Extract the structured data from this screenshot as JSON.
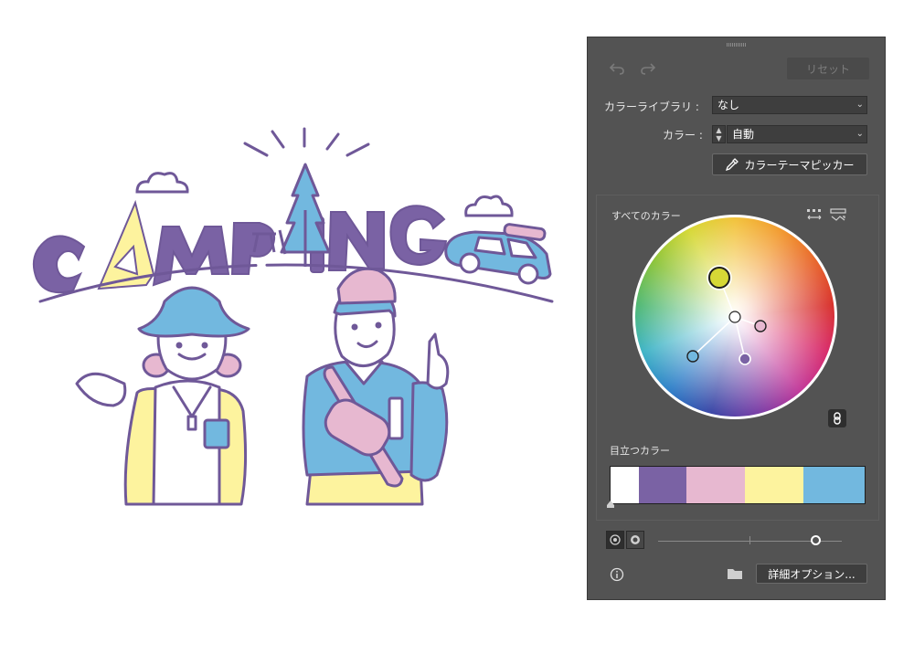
{
  "artwork": {
    "title_text": "CAMPING",
    "palette": {
      "purple": "#7a62a4",
      "pink": "#e7b8d0",
      "yellow": "#fdf39e",
      "blue": "#72b8df",
      "line": "#6f5898"
    }
  },
  "panel": {
    "undo_icon": "undo-icon",
    "redo_icon": "redo-icon",
    "reset_label": "リセット",
    "library_label": "カラーライブラリ :",
    "library_value": "なし",
    "color_label": "カラー :",
    "color_value": "自動",
    "picker_label": "カラーテーマピッカー",
    "all_colors_label": "すべてのカラー",
    "prominent_label": "目立つカラー",
    "prominent_colors": [
      "#ffffff",
      "#7a62a4",
      "#e7b8d0",
      "#fdf39e",
      "#72b8df"
    ],
    "prominent_ratios": [
      0.11,
      0.19,
      0.23,
      0.23,
      0.24
    ],
    "options_label": "詳細オプション...",
    "slider_value": 0.86
  }
}
